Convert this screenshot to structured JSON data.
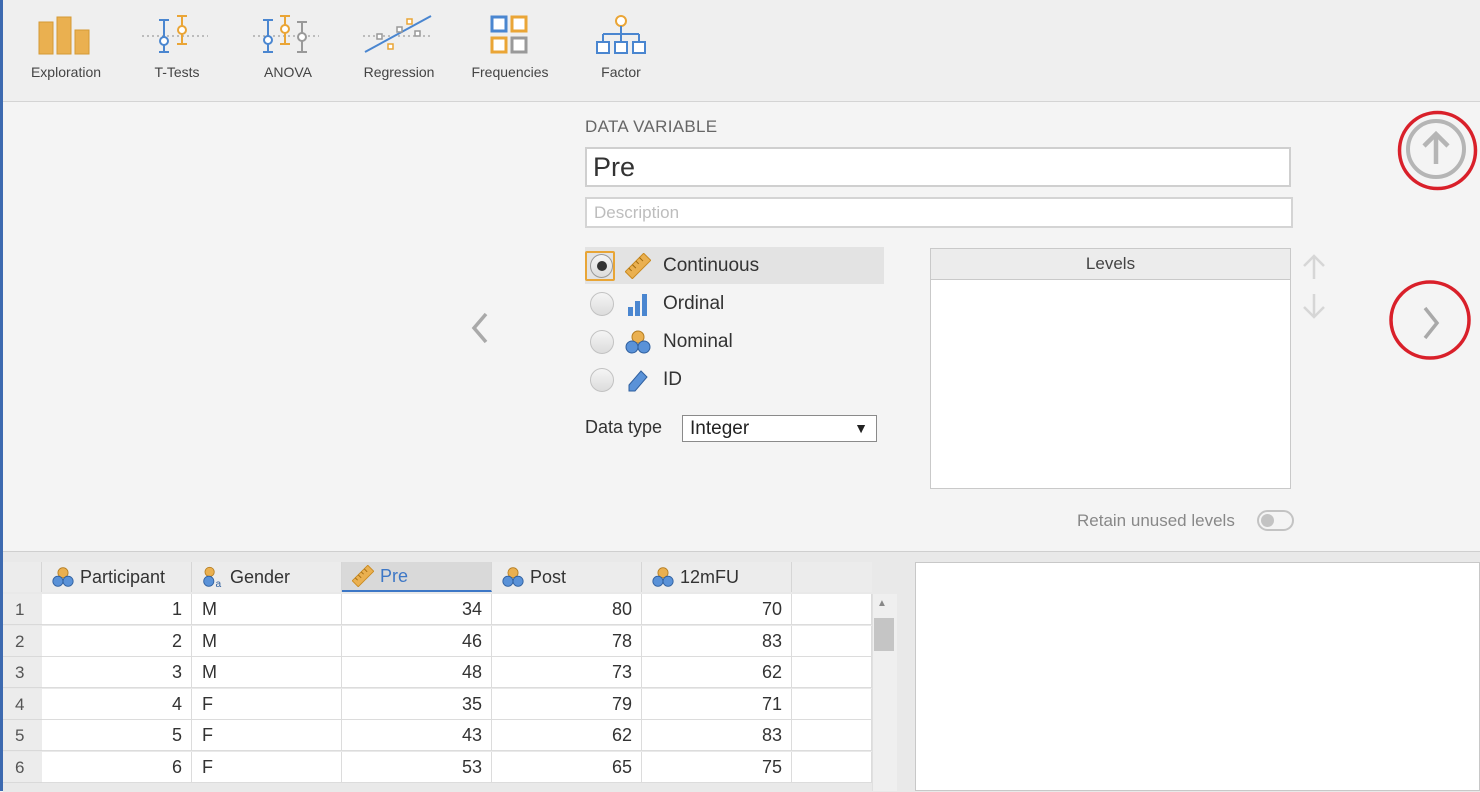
{
  "toolbar": {
    "items": [
      {
        "label": "Exploration",
        "icon": "exploration-icon"
      },
      {
        "label": "T-Tests",
        "icon": "ttests-icon"
      },
      {
        "label": "ANOVA",
        "icon": "anova-icon"
      },
      {
        "label": "Regression",
        "icon": "regression-icon"
      },
      {
        "label": "Frequencies",
        "icon": "frequencies-icon"
      },
      {
        "label": "Factor",
        "icon": "factor-icon"
      }
    ]
  },
  "setup": {
    "section_title": "DATA VARIABLE",
    "name_value": "Pre",
    "description_placeholder": "Description",
    "measure_types": [
      {
        "label": "Continuous",
        "icon": "ruler-icon",
        "selected": true
      },
      {
        "label": "Ordinal",
        "icon": "ordinal-bars-icon",
        "selected": false
      },
      {
        "label": "Nominal",
        "icon": "nominal-circles-icon",
        "selected": false
      },
      {
        "label": "ID",
        "icon": "id-tag-icon",
        "selected": false
      }
    ],
    "data_type_label": "Data type",
    "data_type_value": "Integer",
    "levels_header": "Levels",
    "retain_label": "Retain unused levels",
    "retain_on": false
  },
  "colors": {
    "accent_orange": "#e8a536",
    "accent_blue": "#3d77c6",
    "highlight_red": "#d9202a"
  },
  "grid": {
    "columns": [
      {
        "name": "Participant",
        "icon": "nominal-circles-icon"
      },
      {
        "name": "Gender",
        "icon": "nominal-text-icon"
      },
      {
        "name": "Pre",
        "icon": "ruler-icon"
      },
      {
        "name": "Post",
        "icon": "nominal-circles-icon"
      },
      {
        "name": "12mFU",
        "icon": "nominal-circles-icon"
      }
    ],
    "rows": [
      {
        "n": "1",
        "cells": [
          "1",
          "M",
          "34",
          "80",
          "70"
        ]
      },
      {
        "n": "2",
        "cells": [
          "2",
          "M",
          "46",
          "78",
          "83"
        ]
      },
      {
        "n": "3",
        "cells": [
          "3",
          "M",
          "48",
          "73",
          "62"
        ]
      },
      {
        "n": "4",
        "cells": [
          "4",
          "F",
          "35",
          "79",
          "71"
        ]
      },
      {
        "n": "5",
        "cells": [
          "5",
          "F",
          "43",
          "62",
          "83"
        ]
      },
      {
        "n": "6",
        "cells": [
          "6",
          "F",
          "53",
          "65",
          "75"
        ]
      }
    ]
  }
}
